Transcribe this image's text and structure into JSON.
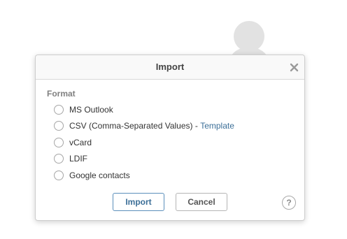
{
  "dialog": {
    "title": "Import",
    "format_label": "Format",
    "options": [
      {
        "label": "MS Outlook",
        "selected": false
      },
      {
        "label": "CSV (Comma-Separated Values)",
        "separator": " - ",
        "link": "Template",
        "selected": false
      },
      {
        "label": "vCard",
        "selected": false
      },
      {
        "label": "LDIF",
        "selected": false
      },
      {
        "label": "Google contacts",
        "selected": false
      }
    ],
    "import_button": "Import",
    "cancel_button": "Cancel",
    "help_symbol": "?"
  },
  "icons": {
    "close": "close-icon",
    "help": "help-icon",
    "avatar": "user-avatar-placeholder"
  },
  "colors": {
    "link": "#3c6f98",
    "primary_border": "#5b8fbb",
    "label_gray": "#808080"
  }
}
